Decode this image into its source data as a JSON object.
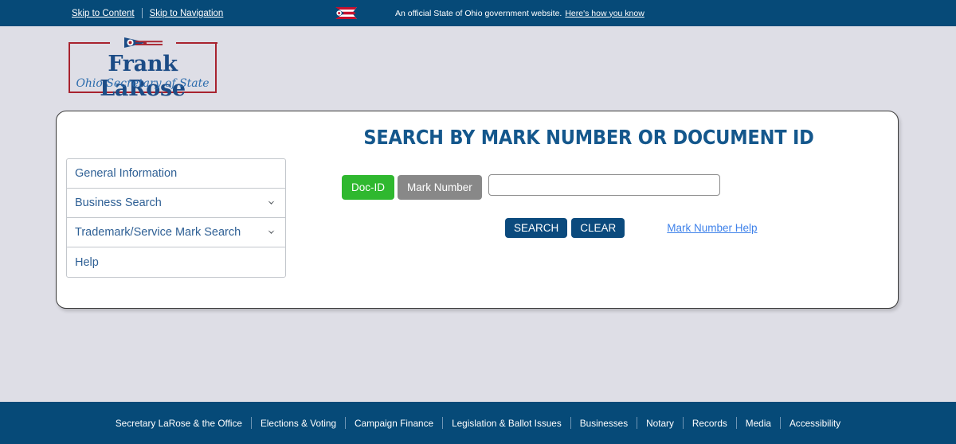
{
  "state_bar": {
    "skip_content": "Skip to Content",
    "skip_nav": "Skip to Navigation",
    "official_text": "An official State of Ohio government website.",
    "official_link": "Here's how you know",
    "flag_icon": "ohio-flag-icon",
    "bg_color": "#064a78"
  },
  "logo": {
    "name": "Frank LaRose",
    "subtitle": "Ohio Secretary of State",
    "pennant_icon": "ohio-pennant-icon",
    "frame_color": "#a8232f",
    "name_color": "#1c4c86"
  },
  "main": {
    "title": "SEARCH BY MARK NUMBER OR DOCUMENT ID",
    "title_color": "#14578c"
  },
  "sidebar": {
    "items": [
      {
        "label": "General Information",
        "expandable": false
      },
      {
        "label": "Business Search",
        "expandable": true
      },
      {
        "label": "Trademark/Service Mark Search",
        "expandable": true
      },
      {
        "label": "Help",
        "expandable": false
      }
    ]
  },
  "search": {
    "toggle": [
      {
        "label": "Doc-ID",
        "state": "active",
        "color": "#2fb82f"
      },
      {
        "label": "Mark Number",
        "state": "inactive",
        "color": "#888888"
      }
    ],
    "input_value": "",
    "input_placeholder": "",
    "search_button": "SEARCH",
    "clear_button": "CLEAR",
    "help_link": "Mark Number Help",
    "help_link_color": "#3f82ea",
    "button_color": "#0b4a7d"
  },
  "footer": {
    "links": [
      "Secretary LaRose & the Office",
      "Elections & Voting",
      "Campaign Finance",
      "Legislation & Ballot Issues",
      "Businesses",
      "Notary",
      "Records",
      "Media",
      "Accessibility"
    ],
    "bg_color": "#064a78"
  }
}
